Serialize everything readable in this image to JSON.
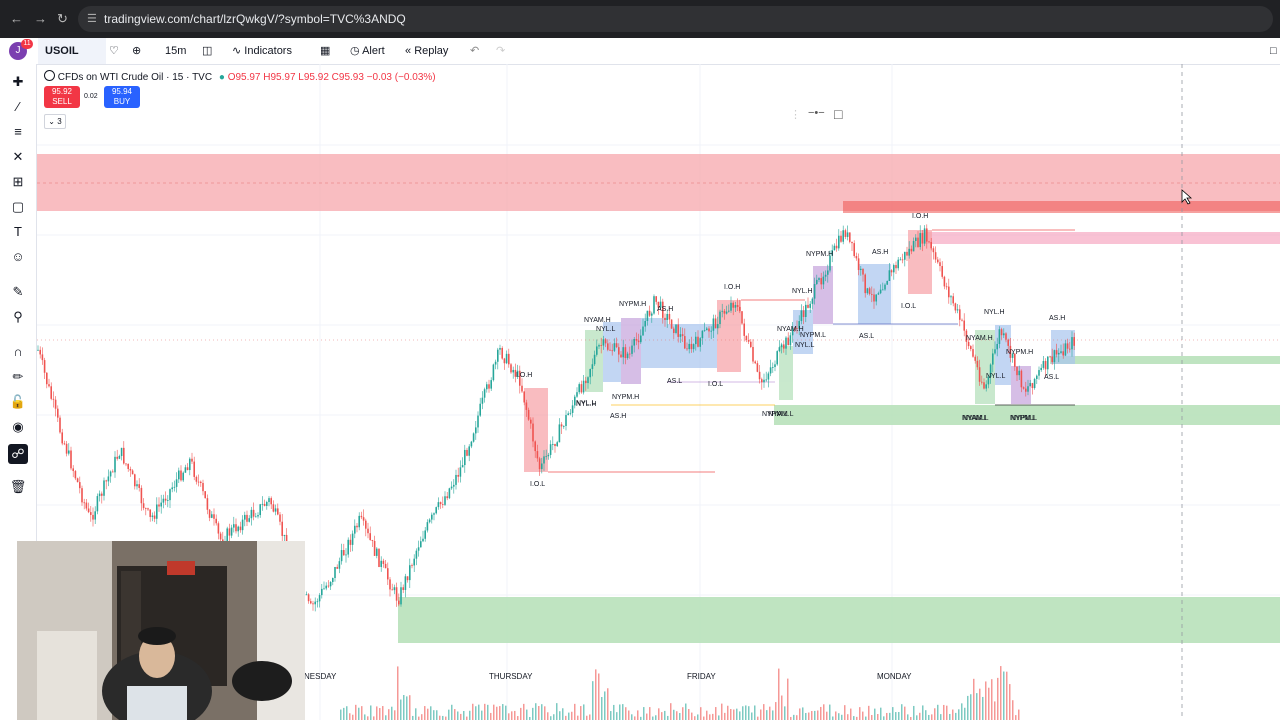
{
  "browser": {
    "back_icon": "arrow-left-icon",
    "forward_icon": "arrow-right-icon",
    "reload_icon": "reload-icon",
    "url": "tradingview.com/chart/lzrQwkgV/?symbol=TVC%3ANDQ"
  },
  "toolbar": {
    "avatar_letter": "J",
    "notification_count": "11",
    "symbol": "USOIL",
    "interval": "15m",
    "indicators_label": "Indicators",
    "alert_label": "Alert",
    "replay_label": "Replay"
  },
  "legend": {
    "title": "CFDs on WTI Crude Oil · 15 · TVC",
    "ohlc": "O95.97 H95.97 L95.92 C95.93 −0.03 (−0.03%)",
    "sell_price": "95.92",
    "sell_label": "SELL",
    "spread": "0.02",
    "buy_price": "95.94",
    "buy_label": "BUY",
    "indicator_count": "3"
  },
  "colors": {
    "bull": "#26a69a",
    "bear": "#ef5350",
    "red_zone": "#f7a1a6",
    "green_zone": "#b4dfb6",
    "blue_box": "#a9c6ef",
    "purple_box": "#c5a3dc",
    "green_box": "#b2dfb8"
  },
  "chart": {
    "labels": [
      "I.O.H",
      "NYPM.H",
      "AS.H",
      "NYL.H",
      "NYAM.H",
      "NYL.L",
      "NYPM.L",
      "AS.L",
      "I.O.L",
      "NYPM.H",
      "AS.H",
      "I.O.H",
      "NYAM.H",
      "NYL.L",
      "AS.L",
      "I.O.L",
      "NYPM.H",
      "AS.H",
      "NYL.H",
      "NYPM.L",
      "NYL.L",
      "NYAM.L",
      "NYAM.L",
      "I.O.H",
      "NYPM.L",
      "I.O.L",
      "NYAM.H",
      "NYPM.H",
      "NYL.L",
      "AS.L",
      "NYL.H",
      "AS.H",
      "NYAM.L",
      "NYPM.L"
    ],
    "days": [
      "NESDAY",
      "THURSDAY",
      "FRIDAY",
      "MONDAY"
    ]
  }
}
